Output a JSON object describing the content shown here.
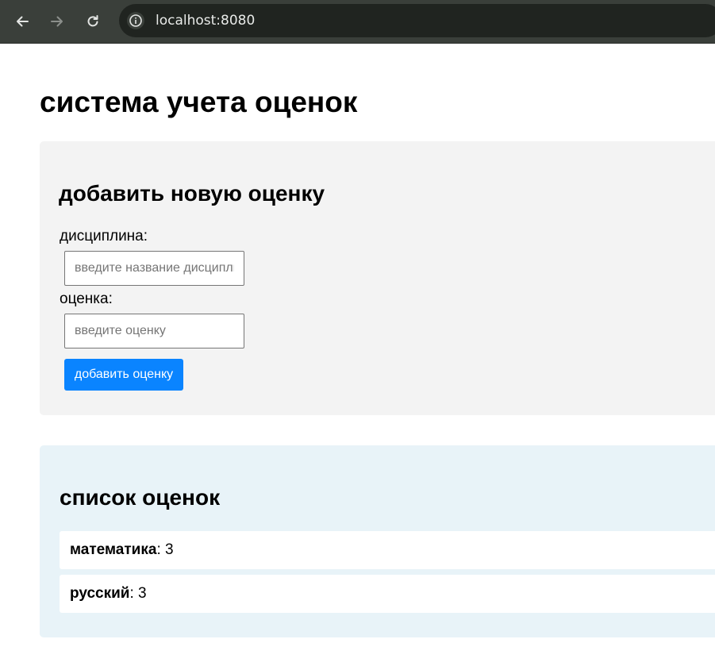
{
  "browser": {
    "url": "localhost:8080"
  },
  "page": {
    "title": "система учета оценок"
  },
  "add_form": {
    "heading": "добавить новую оценку",
    "discipline_label": "дисциплина:",
    "discipline_placeholder": "введите название дисциплины",
    "discipline_value": "",
    "grade_label": "оценка:",
    "grade_placeholder": "введите оценку",
    "grade_value": "",
    "submit_label": "добавить оценку",
    "submit_color": "#0a84ff"
  },
  "grades": {
    "heading": "список оценок",
    "items": [
      {
        "subject": "математика",
        "separator": ":",
        "grade": "3"
      },
      {
        "subject": "русский",
        "separator": ":",
        "grade": "3"
      }
    ]
  },
  "icons": {
    "back": "arrow-left",
    "forward": "arrow-right",
    "reload": "reload",
    "site_info": "info-circle"
  }
}
